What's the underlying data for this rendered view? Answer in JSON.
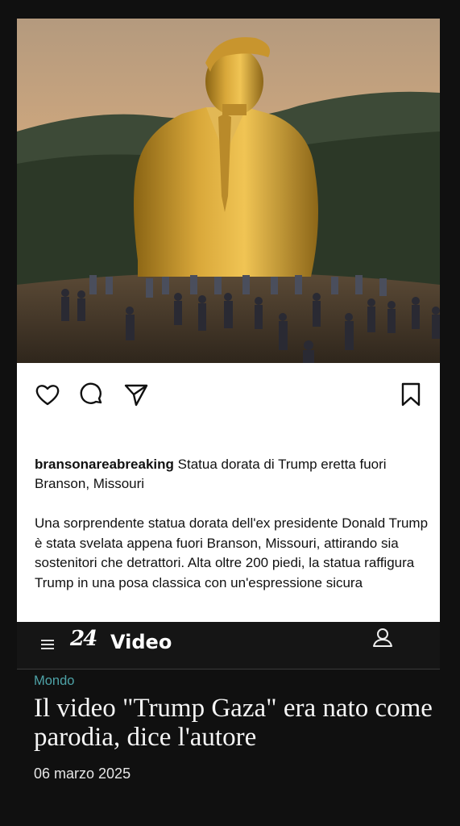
{
  "post": {
    "username": "bransonareabreaking",
    "caption": " Statua dorata di Trump eretta fuori Branson, Missouri",
    "body": "Una sorprendente statua dorata dell'ex presidente Donald Trump è stata svelata appena fuori Branson, Missouri, attirando sia sostenitori che detrattori. Alta oltre 200 piedi, la statua raffigura Trump in una posa classica con un'espressione sicura",
    "icons": [
      "heart-icon",
      "comment-icon",
      "share-icon",
      "bookmark-icon"
    ]
  },
  "site": {
    "logo": "24",
    "section_label": "Video",
    "icons": [
      "menu-icon",
      "user-icon"
    ]
  },
  "article": {
    "category": "Mondo",
    "title": "Il video \"Trump Gaza\" era nato come parodia, dice l'autore",
    "date": "06 marzo 2025"
  },
  "colors": {
    "background": "#101010",
    "card": "#ffffff",
    "category": "#4ea3a8"
  }
}
